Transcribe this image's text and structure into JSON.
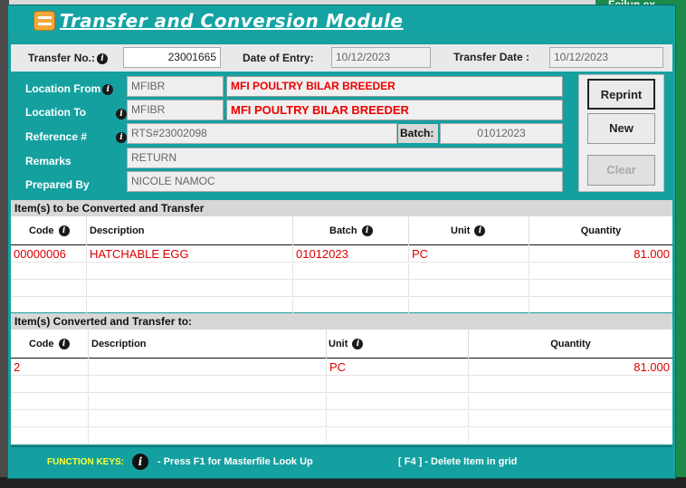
{
  "window": {
    "title": "Transfer and Conversion Module",
    "bg_right_text": "Feilun.ex"
  },
  "header": {
    "transfer_no_label": "Transfer No.:",
    "transfer_no": "23001665",
    "date_of_entry_label": "Date of Entry:",
    "date_of_entry": "10/12/2023",
    "transfer_date_label": "Transfer Date :",
    "transfer_date": "10/12/2023"
  },
  "details": {
    "location_from_label": "Location From",
    "location_from_code": "MFIBR",
    "location_from_name": "MFI POULTRY BILAR BREEDER",
    "location_to_label": "Location To",
    "location_to_code": "MFIBR",
    "location_to_name": "MFI POULTRY BILAR BREEDER",
    "reference_label": "Reference #",
    "reference": "RTS#23002098",
    "batch_label": "Batch:",
    "batch": "01012023",
    "remarks_label": "Remarks",
    "remarks": "RETURN",
    "prepared_by_label": "Prepared By",
    "prepared_by": "NICOLE NAMOC"
  },
  "buttons": {
    "reprint": "Reprint",
    "new": "New",
    "clear": "Clear"
  },
  "source_grid": {
    "title": "Item(s) to be Converted and Transfer",
    "columns": [
      "Code",
      "Description",
      "Batch",
      "Unit",
      "Quantity"
    ],
    "rows": [
      {
        "code": "00000006",
        "description": "HATCHABLE EGG",
        "batch": "01012023",
        "unit": "PC",
        "quantity": "81.000"
      }
    ]
  },
  "target_grid": {
    "title": "Item(s) Converted and Transfer to:",
    "columns": [
      "Code",
      "Description",
      "Unit",
      "Quantity"
    ],
    "rows": [
      {
        "code": "2",
        "description": "",
        "unit": "PC",
        "quantity": "81.000"
      }
    ]
  },
  "footer": {
    "function_keys_label": "FUNCTION KEYS:",
    "f1_hint": "- Press F1 for Masterfile Look Up",
    "f4_hint": "[ F4 ] - Delete Item in grid"
  },
  "colors": {
    "teal": "#16a0a0",
    "red_text": "#e00000",
    "yellow": "#ffff33"
  }
}
